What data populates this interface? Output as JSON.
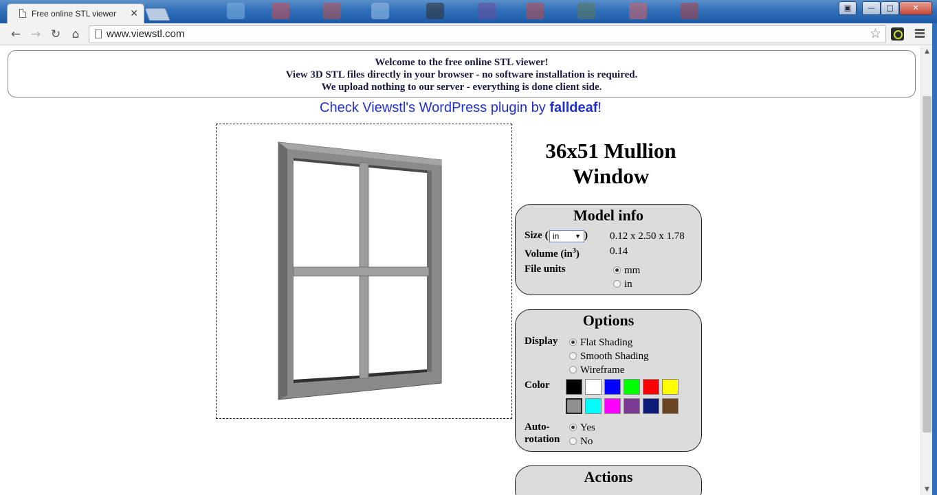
{
  "browser": {
    "tab_title": "Free online STL viewer",
    "tab_close": "✕",
    "url": "www.viewstl.com"
  },
  "banner": {
    "line1": "Welcome to the free online STL viewer!",
    "line2": "View 3D STL files directly in your browser - no software installation is required.",
    "line3": "We upload nothing to our server - everything is done client side."
  },
  "plugin": {
    "prefix": "Check Viewstl's WordPress plugin by ",
    "author": "falldeaf",
    "suffix": "!"
  },
  "model": {
    "title": "36x51 Mullion Window"
  },
  "model_info": {
    "heading": "Model info",
    "size_label_pre": "Size (",
    "size_label_post": ")",
    "size_unit": "in",
    "size_value": "0.12 x 2.50 x 1.78",
    "volume_label_pre": "Volume (in",
    "volume_sup": "3",
    "volume_label_post": ")",
    "volume_value": "0.14",
    "file_units_label": "File units",
    "unit_mm": "mm",
    "unit_in": "in",
    "selected_unit": "mm"
  },
  "options": {
    "heading": "Options",
    "display_label": "Display",
    "display_flat": "Flat Shading",
    "display_smooth": "Smooth Shading",
    "display_wire": "Wireframe",
    "selected_display": "flat",
    "color_label": "Color",
    "colors": [
      "#000000",
      "#ffffff",
      "#0000ff",
      "#00ff00",
      "#ff0000",
      "#ffff00",
      "#909090",
      "#00ffff",
      "#ff00ff",
      "#7a3a90",
      "#0d1a78",
      "#6b4522"
    ],
    "selected_color": "#909090",
    "autorotation_label_1": "Auto-",
    "autorotation_label_2": "rotation",
    "autorotation_yes": "Yes",
    "autorotation_no": "No",
    "selected_autorotation": "yes"
  },
  "actions": {
    "heading": "Actions"
  }
}
